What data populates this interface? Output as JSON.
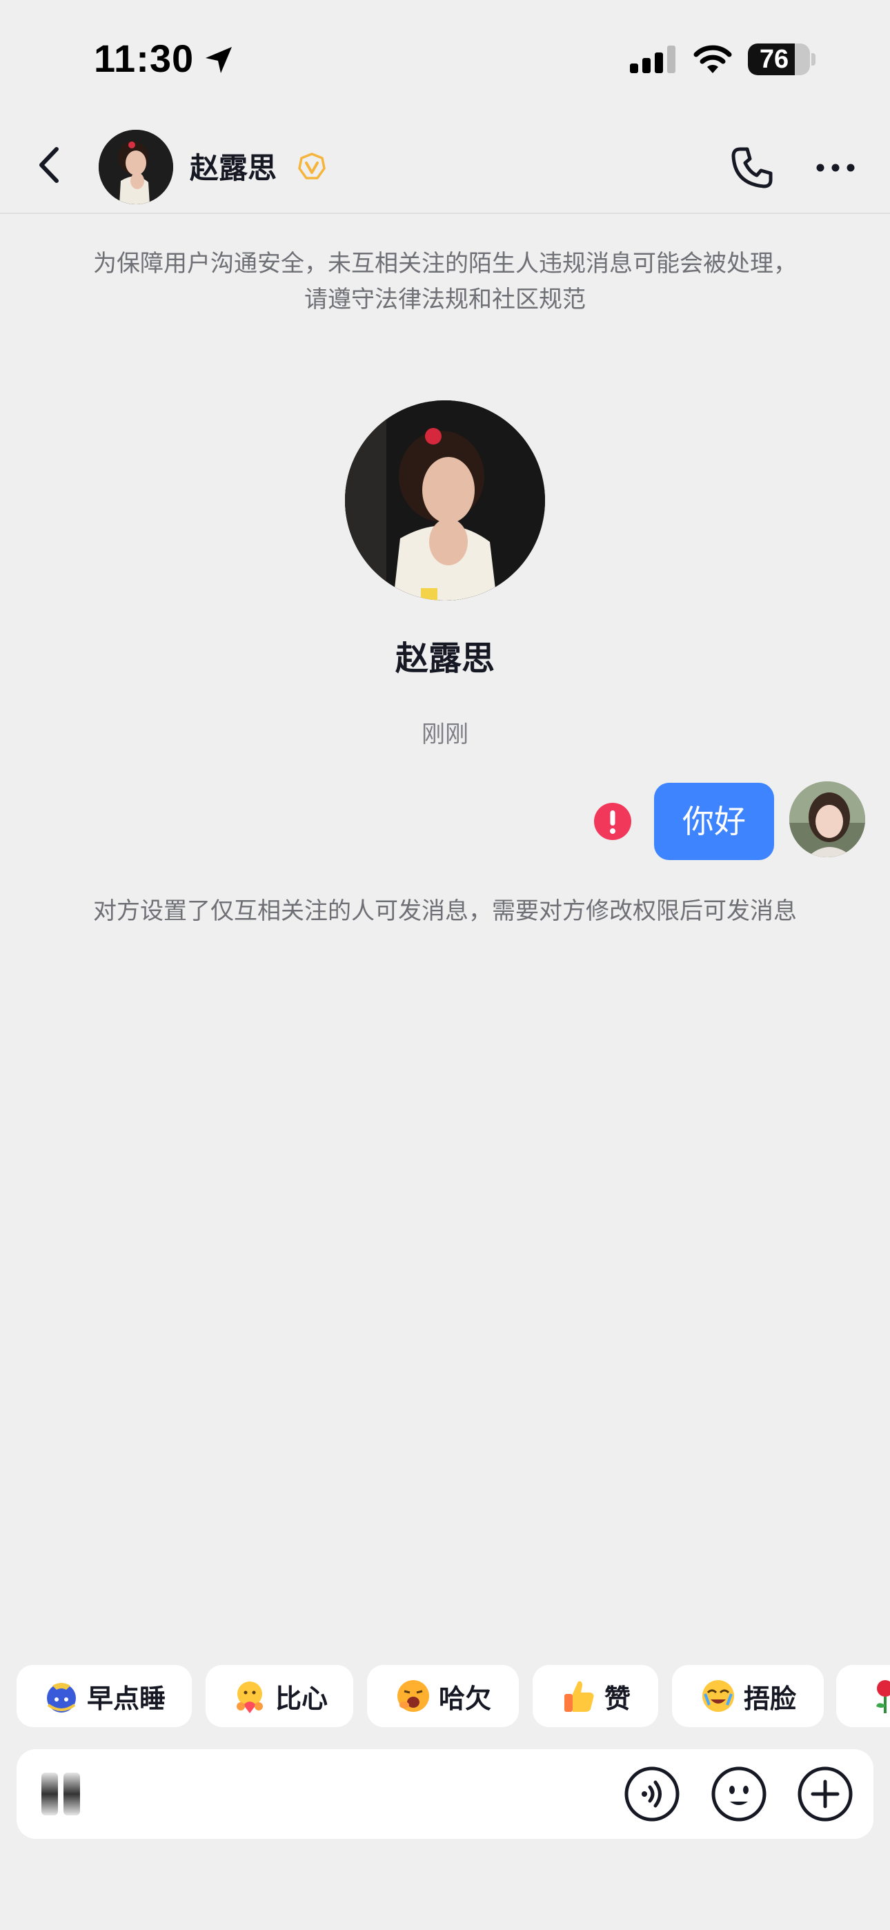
{
  "status_bar": {
    "time": "11:30",
    "battery": "76",
    "icons": [
      "location-arrow-icon",
      "signal-icon",
      "wifi-icon",
      "battery-icon"
    ]
  },
  "header": {
    "contact_name": "赵露思",
    "badge": "verified-icon",
    "accent_color": "#f5b53c",
    "actions": [
      "phone-icon",
      "more-icon"
    ]
  },
  "chat": {
    "safety_notice": "为保障用户沟通安全，未互相关注的陌生人违规消息可能会被处理，请遵守法律法规和社区规范",
    "profile_name": "赵露思",
    "timestamp": "刚刚",
    "messages": [
      {
        "sender": "self",
        "text": "你好",
        "status": "failed"
      }
    ],
    "restriction_notice": "对方设置了仅互相关注的人可发消息，需要对方修改权限后可发消息",
    "bubble_color": "#3f84ff",
    "error_color": "#f2385a"
  },
  "quick_replies": [
    {
      "emoji": "moon-sleep-emoji",
      "label": "早点睡"
    },
    {
      "emoji": "heart-hands-emoji",
      "label": "比心"
    },
    {
      "emoji": "yawn-emoji",
      "label": "哈欠"
    },
    {
      "emoji": "thumbs-up-emoji",
      "label": "赞"
    },
    {
      "emoji": "cover-face-emoji",
      "label": "捂脸"
    },
    {
      "emoji": "rose-emoji",
      "label": ""
    }
  ],
  "input": {
    "placeholder": "",
    "icons": [
      "waveform-icon",
      "voice-icon",
      "emoji-icon",
      "plus-icon"
    ]
  }
}
